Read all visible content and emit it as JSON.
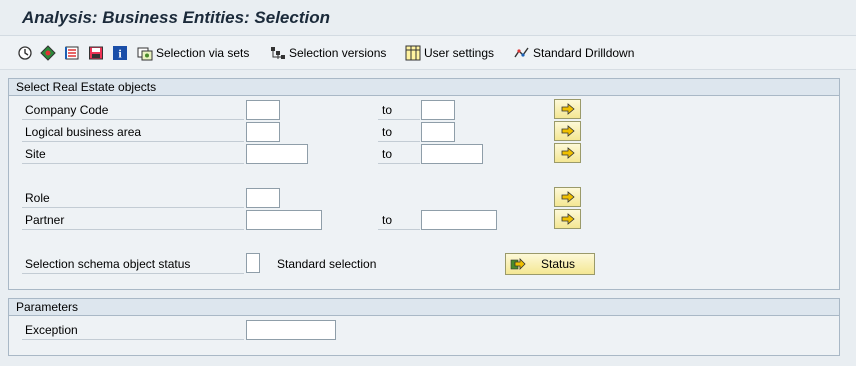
{
  "title": "Analysis: Business Entities: Selection",
  "toolbar": {
    "items": [
      {
        "label": "Selection via sets"
      },
      {
        "label": "Selection versions"
      },
      {
        "label": "User settings"
      },
      {
        "label": "Standard Drilldown"
      }
    ]
  },
  "objects": {
    "header": "Select Real Estate objects",
    "to_label": "to",
    "rows": [
      {
        "label": "Company Code"
      },
      {
        "label": "Logical business area"
      },
      {
        "label": "Site"
      },
      {
        "label": "Role"
      },
      {
        "label": "Partner"
      }
    ],
    "status_row": {
      "label": "Selection schema object status",
      "value_text": "Standard selection",
      "button_label": "Status"
    }
  },
  "parameters": {
    "header": "Parameters",
    "exception_label": "Exception"
  },
  "colors": {
    "title": "#1b2a3a",
    "button_bg": "#f4e793",
    "header_bg": "#dde6ee"
  }
}
